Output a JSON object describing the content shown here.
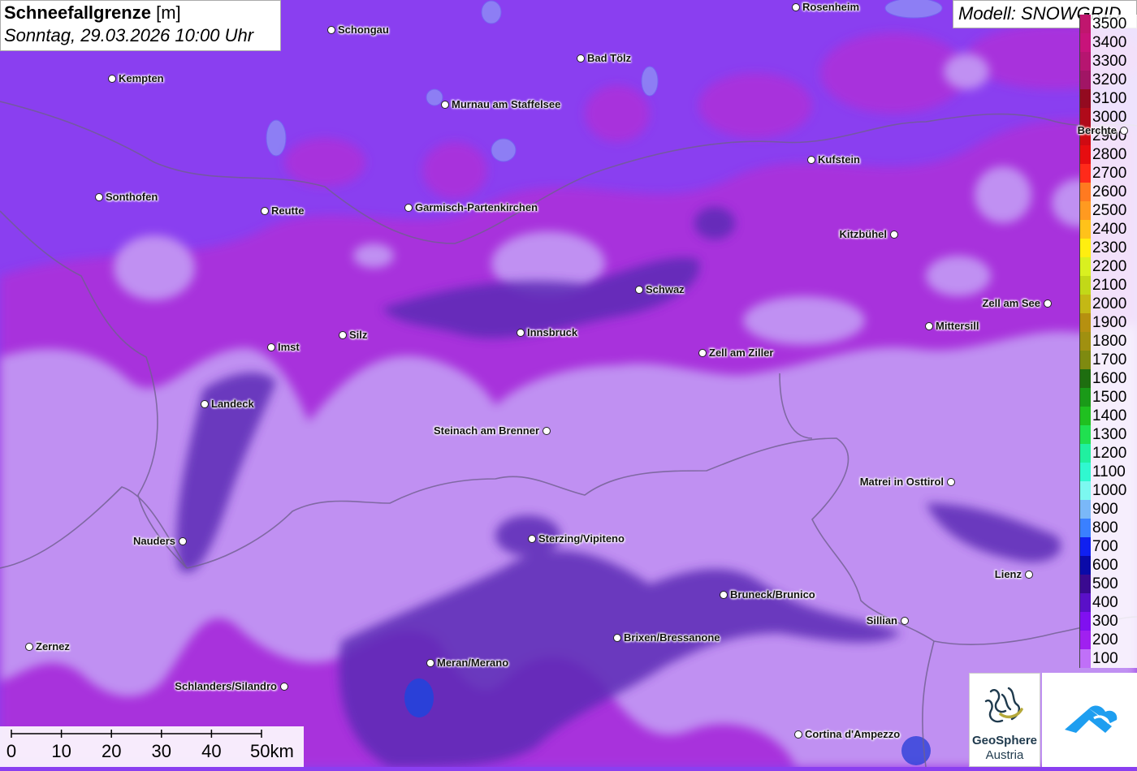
{
  "title": {
    "bold": "Schneefallgrenze",
    "unit": "[m]",
    "date": "Sonntag, 29.03.2026 10:00 Uhr"
  },
  "model": "Modell: SNOWGRID",
  "legend": [
    {
      "label": "3500",
      "color": "#c0166e"
    },
    {
      "label": "3400",
      "color": "#c8137a"
    },
    {
      "label": "3300",
      "color": "#b61570"
    },
    {
      "label": "3200",
      "color": "#a11565"
    },
    {
      "label": "3100",
      "color": "#930a20"
    },
    {
      "label": "3000",
      "color": "#b00a1a"
    },
    {
      "label": "2900",
      "color": "#cf0a12"
    },
    {
      "label": "2800",
      "color": "#e60d10"
    },
    {
      "label": "2700",
      "color": "#ff2a1a"
    },
    {
      "label": "2600",
      "color": "#ff7a20"
    },
    {
      "label": "2500",
      "color": "#ff9a20"
    },
    {
      "label": "2400",
      "color": "#ffc21a"
    },
    {
      "label": "2300",
      "color": "#ffee10"
    },
    {
      "label": "2200",
      "color": "#d9f020"
    },
    {
      "label": "2100",
      "color": "#c2d818"
    },
    {
      "label": "2000",
      "color": "#c4b815"
    },
    {
      "label": "1900",
      "color": "#b69010"
    },
    {
      "label": "1800",
      "color": "#a09010"
    },
    {
      "label": "1700",
      "color": "#7e8a10"
    },
    {
      "label": "1600",
      "color": "#1e6e10"
    },
    {
      "label": "1500",
      "color": "#1a9a18"
    },
    {
      "label": "1400",
      "color": "#20c020"
    },
    {
      "label": "1300",
      "color": "#20e050"
    },
    {
      "label": "1200",
      "color": "#20f0a0"
    },
    {
      "label": "1100",
      "color": "#30f8d0"
    },
    {
      "label": "1000",
      "color": "#7cf8f0"
    },
    {
      "label": "900",
      "color": "#7ab8f8"
    },
    {
      "label": "800",
      "color": "#3a80ff"
    },
    {
      "label": "700",
      "color": "#1020f0"
    },
    {
      "label": "600",
      "color": "#0a0aa8"
    },
    {
      "label": "500",
      "color": "#3a0a90"
    },
    {
      "label": "400",
      "color": "#5a10c8"
    },
    {
      "label": "300",
      "color": "#8010f0"
    },
    {
      "label": "200",
      "color": "#a020f0"
    },
    {
      "label": "100",
      "color": "#c070f8"
    }
  ],
  "cities": [
    {
      "name": "Rosenheim",
      "side": "right"
    },
    {
      "name": "Schongau",
      "side": "right"
    },
    {
      "name": "Kempten",
      "side": "right"
    },
    {
      "name": "Bad Tölz",
      "side": "right"
    },
    {
      "name": "Murnau am Staffelsee",
      "side": "right"
    },
    {
      "name": "Berchte",
      "side": "left"
    },
    {
      "name": "Kufstein",
      "side": "right"
    },
    {
      "name": "Sonthofen",
      "side": "right"
    },
    {
      "name": "Reutte",
      "side": "right"
    },
    {
      "name": "Garmisch-Partenkirchen",
      "side": "right"
    },
    {
      "name": "Kitzbühel",
      "side": "left"
    },
    {
      "name": "Schwaz",
      "side": "right"
    },
    {
      "name": "Zell am See",
      "side": "left"
    },
    {
      "name": "Mittersill",
      "side": "right"
    },
    {
      "name": "Imst",
      "side": "right"
    },
    {
      "name": "Silz",
      "side": "right"
    },
    {
      "name": "Innsbruck",
      "side": "right"
    },
    {
      "name": "Zell am Ziller",
      "side": "right"
    },
    {
      "name": "Landeck",
      "side": "right"
    },
    {
      "name": "Steinach am Brenner",
      "side": "left"
    },
    {
      "name": "Matrei in Osttirol",
      "side": "left"
    },
    {
      "name": "Nauders",
      "side": "left"
    },
    {
      "name": "Sterzing/Vipiteno",
      "side": "right"
    },
    {
      "name": "Lienz",
      "side": "left"
    },
    {
      "name": "Bruneck/Brunico",
      "side": "right"
    },
    {
      "name": "Sillian",
      "side": "left"
    },
    {
      "name": "Brixen/Bressanone",
      "side": "right"
    },
    {
      "name": "Zernez",
      "side": "right"
    },
    {
      "name": "Meran/Merano",
      "side": "right"
    },
    {
      "name": "Schlanders/Silandro",
      "side": "left"
    },
    {
      "name": "Cortina d'Ampezzo",
      "side": "right"
    }
  ],
  "scale": {
    "ticks": [
      "0",
      "10",
      "20",
      "30",
      "40",
      "50km"
    ]
  },
  "logos": {
    "geosphere_name": "GeoSphere",
    "geosphere_sub": "Austria",
    "geosphere_icon": "geosphere-logo-icon",
    "snow_icon": "snow-cloud-logo-icon"
  },
  "colors": {
    "base_purple": "#8a3ff0",
    "light_purple": "#c090f2",
    "dark_purple": "#5b2ab5",
    "magenta": "#b22fd6"
  }
}
